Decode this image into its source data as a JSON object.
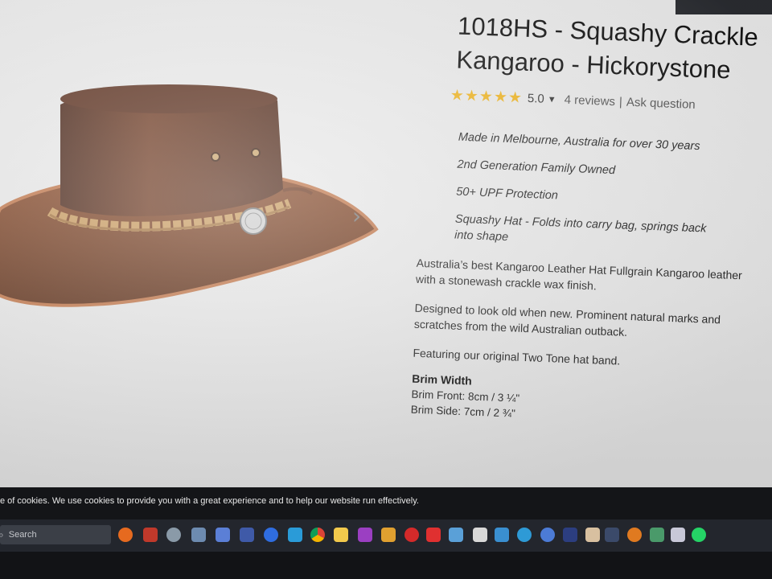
{
  "product": {
    "title_line1": "1018HS - Squashy Crackle",
    "title_line2": "Kangaroo - Hickorystone",
    "rating_value": "5.0",
    "reviews_link": "4 reviews",
    "separator": "|",
    "ask_link": "Ask question",
    "features": [
      "Made in Melbourne, Australia for over 30 years",
      "2nd Generation Family Owned",
      "50+ UPF Protection",
      "Squashy Hat - Folds into carry bag, springs back into shape"
    ],
    "paragraph1": "Australia’s best Kangaroo Leather Hat Fullgrain Kangaroo leather with a stonewash crackle wax finish.",
    "paragraph2": "Designed to look old when new. Prominent natural marks and scratches from the wild Australian outback.",
    "paragraph3": "Featuring our original Two Tone hat band.",
    "brim_heading": "Brim Width",
    "brim_front": "Brim Front: 8cm / 3 ¼\"",
    "brim_side": "Brim Side: 7cm / 2 ¾\""
  },
  "gallery": {
    "next_arrow": "›"
  },
  "cookie_bar": {
    "text": "e of cookies. We use cookies to provide you with a great experience and to help our website run effectively."
  },
  "taskbar": {
    "search_placeholder": "Search"
  },
  "colors": {
    "star": "#f0b41e",
    "hat_leather": "#7a4326",
    "hat_band": "#c89a5e",
    "taskbar": "#23262d"
  }
}
